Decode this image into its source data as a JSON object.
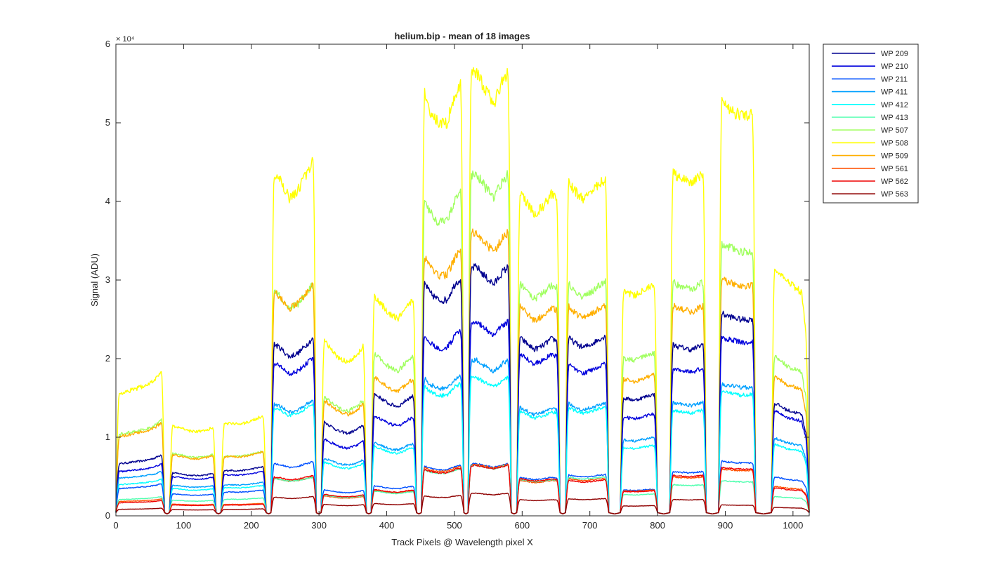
{
  "chart_data": {
    "type": "line",
    "title": "helium.bip - mean of 18 images",
    "xlabel": "Track Pixels @ Wavelength pixel X",
    "ylabel": "Signal (ADU)",
    "y_exponent_label": "× 10⁴",
    "xlim": [
      0,
      1024
    ],
    "ylim": [
      0,
      60000
    ],
    "x_ticks": [
      0,
      100,
      200,
      300,
      400,
      500,
      600,
      700,
      800,
      900,
      1000
    ],
    "x_tick_labels": [
      "0",
      "100",
      "200",
      "300",
      "400",
      "500",
      "600",
      "700",
      "800",
      "900",
      "1000"
    ],
    "y_ticks": [
      0,
      10000,
      20000,
      30000,
      40000,
      50000,
      60000
    ],
    "y_tick_labels": [
      "0",
      "1",
      "2",
      "3",
      "4",
      "5",
      "6"
    ],
    "grid": false,
    "legend_position": "outside-top-right",
    "segments": [
      {
        "x_start": 0,
        "x_end": 72,
        "shape": [
          0.82,
          0.84,
          0.86,
          0.88,
          0.92,
          1.0
        ]
      },
      {
        "x_start": 79,
        "x_end": 148,
        "shape": [
          1.0,
          0.98,
          0.94,
          0.93,
          0.95,
          1.0
        ]
      },
      {
        "x_start": 155,
        "x_end": 222,
        "shape": [
          0.9,
          0.92,
          0.91,
          0.93,
          0.97,
          1.0
        ]
      },
      {
        "x_start": 229,
        "x_end": 296,
        "shape": [
          0.96,
          0.93,
          0.88,
          0.9,
          0.95,
          1.0
        ]
      },
      {
        "x_start": 303,
        "x_end": 370,
        "shape": [
          1.0,
          0.94,
          0.88,
          0.86,
          0.9,
          0.98
        ]
      },
      {
        "x_start": 377,
        "x_end": 444,
        "shape": [
          1.0,
          0.95,
          0.9,
          0.88,
          0.94,
          0.98
        ]
      },
      {
        "x_start": 451,
        "x_end": 514,
        "shape": [
          1.0,
          0.93,
          0.9,
          0.9,
          0.97,
          1.0
        ]
      },
      {
        "x_start": 520,
        "x_end": 584,
        "shape": [
          0.98,
          0.99,
          0.95,
          0.92,
          0.97,
          1.0
        ]
      },
      {
        "x_start": 592,
        "x_end": 656,
        "shape": [
          1.0,
          0.96,
          0.92,
          0.94,
          0.98,
          0.96
        ]
      },
      {
        "x_start": 664,
        "x_end": 728,
        "shape": [
          1.0,
          0.96,
          0.93,
          0.95,
          0.98,
          1.0
        ]
      },
      {
        "x_start": 745,
        "x_end": 800,
        "shape": [
          0.97,
          0.96,
          0.95,
          0.97,
          0.99,
          1.0
        ]
      },
      {
        "x_start": 818,
        "x_end": 872,
        "shape": [
          1.0,
          0.98,
          0.97,
          0.96,
          0.98,
          1.0
        ]
      },
      {
        "x_start": 890,
        "x_end": 945,
        "shape": [
          1.0,
          0.98,
          0.97,
          0.96,
          0.96,
          0.97
        ]
      },
      {
        "x_start": 968,
        "x_end": 1024,
        "shape": [
          1.0,
          0.97,
          0.93,
          0.91,
          0.89,
          0.6
        ]
      }
    ],
    "series": [
      {
        "name": "WP 209",
        "color": "#00008f",
        "plateau_levels": [
          8000,
          5500,
          6300,
          23000,
          12200,
          15800,
          30500,
          32000,
          23000,
          23000,
          15500,
          22000,
          26000,
          14500
        ]
      },
      {
        "name": "WP 210",
        "color": "#0000dd",
        "plateau_levels": [
          6800,
          5000,
          5700,
          20500,
          10000,
          13000,
          23700,
          25000,
          21000,
          19500,
          13000,
          19000,
          23000,
          13500
        ]
      },
      {
        "name": "WP 211",
        "color": "#0050ff",
        "plateau_levels": [
          4200,
          2800,
          3300,
          7000,
          3400,
          3900,
          6500,
          6700,
          5000,
          5300,
          3400,
          5700,
          7000,
          5000
        ]
      },
      {
        "name": "WP 411",
        "color": "#00a0ff",
        "plateau_levels": [
          5800,
          3900,
          4300,
          15000,
          7500,
          9500,
          18000,
          20000,
          14000,
          14500,
          10000,
          14600,
          17000,
          10000
        ]
      },
      {
        "name": "WP 412",
        "color": "#00ffff",
        "plateau_levels": [
          4800,
          3500,
          3900,
          14500,
          7000,
          9000,
          17000,
          17800,
          13500,
          14000,
          9000,
          13600,
          16000,
          9200
        ]
      },
      {
        "name": "WP 413",
        "color": "#50ffaf",
        "plateau_levels": [
          2500,
          2000,
          2300,
          5000,
          2700,
          3200,
          6000,
          6500,
          4700,
          5000,
          2800,
          4000,
          4500,
          2500
        ]
      },
      {
        "name": "WP 507",
        "color": "#a0ff5f",
        "plateau_levels": [
          12500,
          8000,
          8300,
          30000,
          15500,
          21000,
          41500,
          44000,
          30000,
          30000,
          20800,
          30000,
          35000,
          20500
        ]
      },
      {
        "name": "WP 508",
        "color": "#ffff00",
        "plateau_levels": [
          18800,
          11500,
          12800,
          46000,
          22700,
          28500,
          55500,
          57000,
          41800,
          43200,
          29500,
          44000,
          53000,
          32000
        ]
      },
      {
        "name": "WP 509",
        "color": "#ffaf00",
        "plateau_levels": [
          12200,
          7800,
          8200,
          30000,
          15000,
          18000,
          34000,
          36500,
          27000,
          27000,
          18000,
          27000,
          30500,
          18000
        ]
      },
      {
        "name": "WP 561",
        "color": "#ff5000",
        "plateau_levels": [
          2200,
          1500,
          1600,
          5000,
          2600,
          3300,
          6300,
          6600,
          4600,
          4800,
          3300,
          5000,
          6000,
          3800
        ]
      },
      {
        "name": "WP 562",
        "color": "#ee0000",
        "plateau_levels": [
          2000,
          1400,
          1500,
          5200,
          2800,
          3400,
          6100,
          6500,
          4800,
          4600,
          3200,
          5200,
          6200,
          3600
        ]
      },
      {
        "name": "WP 563",
        "color": "#8f0000",
        "plateau_levels": [
          1000,
          800,
          900,
          2500,
          1500,
          1600,
          2600,
          2900,
          2100,
          2200,
          1300,
          2100,
          1400,
          1100
        ]
      }
    ]
  }
}
